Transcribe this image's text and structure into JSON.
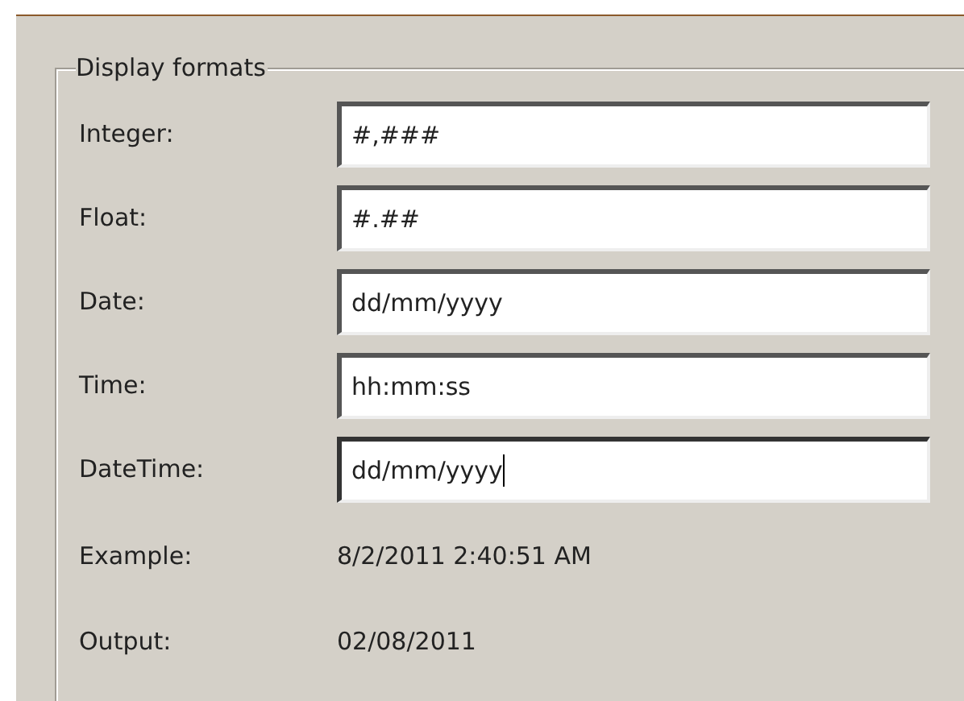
{
  "group": {
    "title": "Display formats"
  },
  "fields": [
    {
      "label": "Integer:",
      "value": "#,###",
      "focused": false
    },
    {
      "label": "Float:",
      "value": "#.##",
      "focused": false
    },
    {
      "label": "Date:",
      "value": "dd/mm/yyyy",
      "focused": false
    },
    {
      "label": "Time:",
      "value": "hh:mm:ss",
      "focused": false
    },
    {
      "label": "DateTime:",
      "value": "dd/mm/yyyy",
      "focused": true
    }
  ],
  "readouts": [
    {
      "label": "Example:",
      "value": "8/2/2011 2:40:51 AM"
    },
    {
      "label": "Output:",
      "value": "02/08/2011"
    }
  ]
}
